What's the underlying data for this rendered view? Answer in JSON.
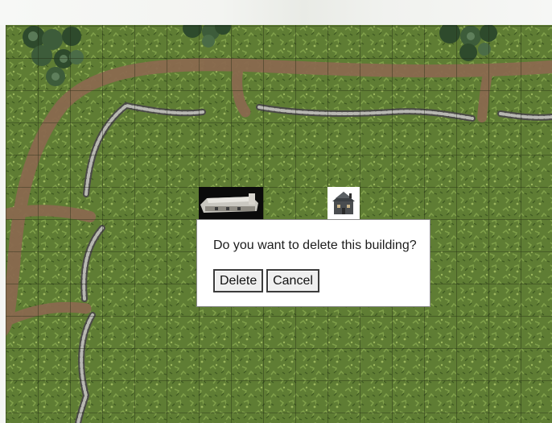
{
  "confirm_dialog": {
    "message": "Do you want to delete this building?",
    "delete_label": "Delete",
    "cancel_label": "Cancel"
  },
  "map": {
    "grid_visible": true,
    "terrain": "grassland",
    "features": [
      "dirt-road",
      "stone-wall",
      "tree-cluster"
    ]
  },
  "buildings": [
    {
      "icon": "longhouse-building-icon"
    },
    {
      "icon": "house-building-icon"
    }
  ],
  "colors": {
    "grass": "#5f7d34",
    "road": "#8a6a4f",
    "grid_line": "#1a2410",
    "dialog_bg": "#ffffff"
  }
}
